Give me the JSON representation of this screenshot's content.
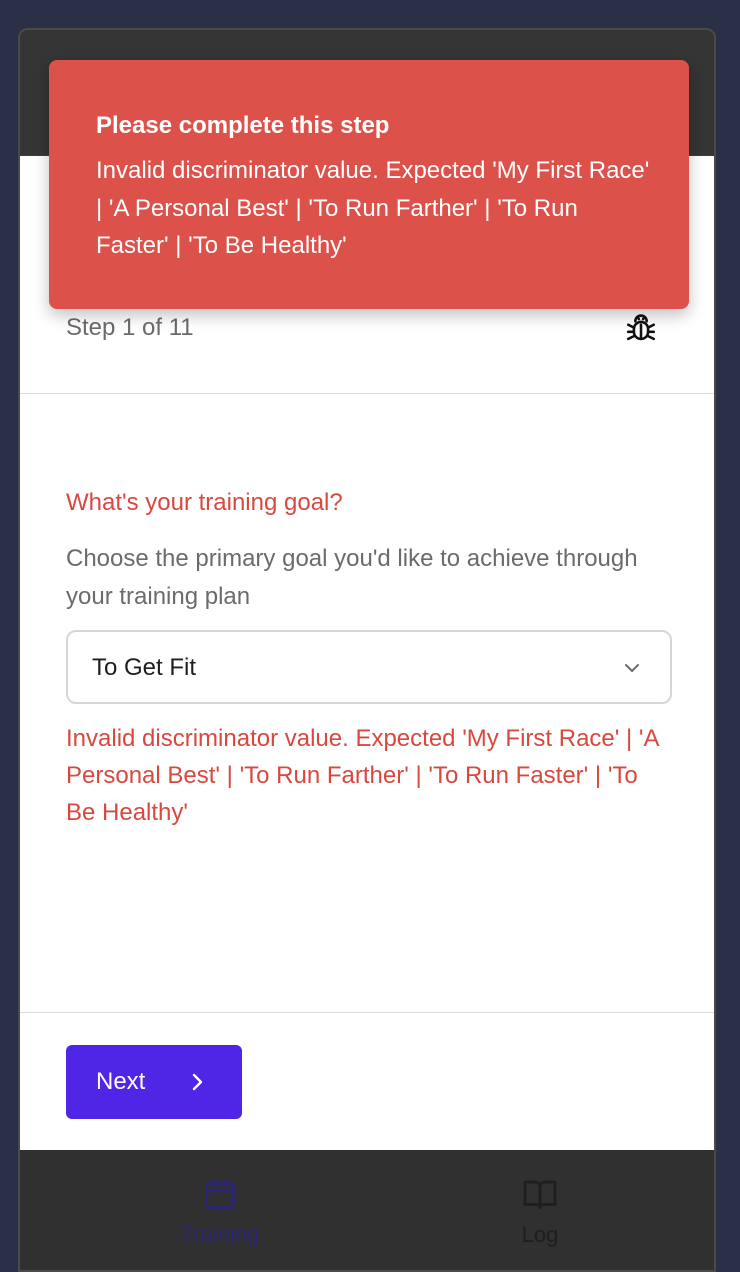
{
  "toast": {
    "title": "Please complete this step",
    "message": "Invalid discriminator value. Expected 'My First Race' | 'A Personal Best' | 'To Run Farther' | 'To Run Faster' | 'To Be Healthy'"
  },
  "step": {
    "label": "Step 1 of 11",
    "current": 1,
    "total": 11
  },
  "form": {
    "question": "What's your training goal?",
    "description": "Choose the primary goal you'd like to achieve through your training plan",
    "select_value": "To Get Fit",
    "error": "Invalid discriminator value. Expected 'My First Race' | 'A Personal Best' | 'To Run Farther' | 'To Run Faster' | 'To Be Healthy'"
  },
  "footer": {
    "next_label": "Next"
  },
  "tabs": [
    {
      "label": "Training",
      "icon": "calendar-icon",
      "active": true
    },
    {
      "label": "Log",
      "icon": "book-icon",
      "active": false
    }
  ],
  "colors": {
    "error": "#d9483f",
    "toast_bg": "#dc524a",
    "primary": "#4f25e6",
    "active_tab": "#2a2575"
  },
  "icons": {
    "debug": "bug-icon",
    "select_chevron": "chevron-down-icon",
    "next_chevron": "chevron-right-icon"
  }
}
